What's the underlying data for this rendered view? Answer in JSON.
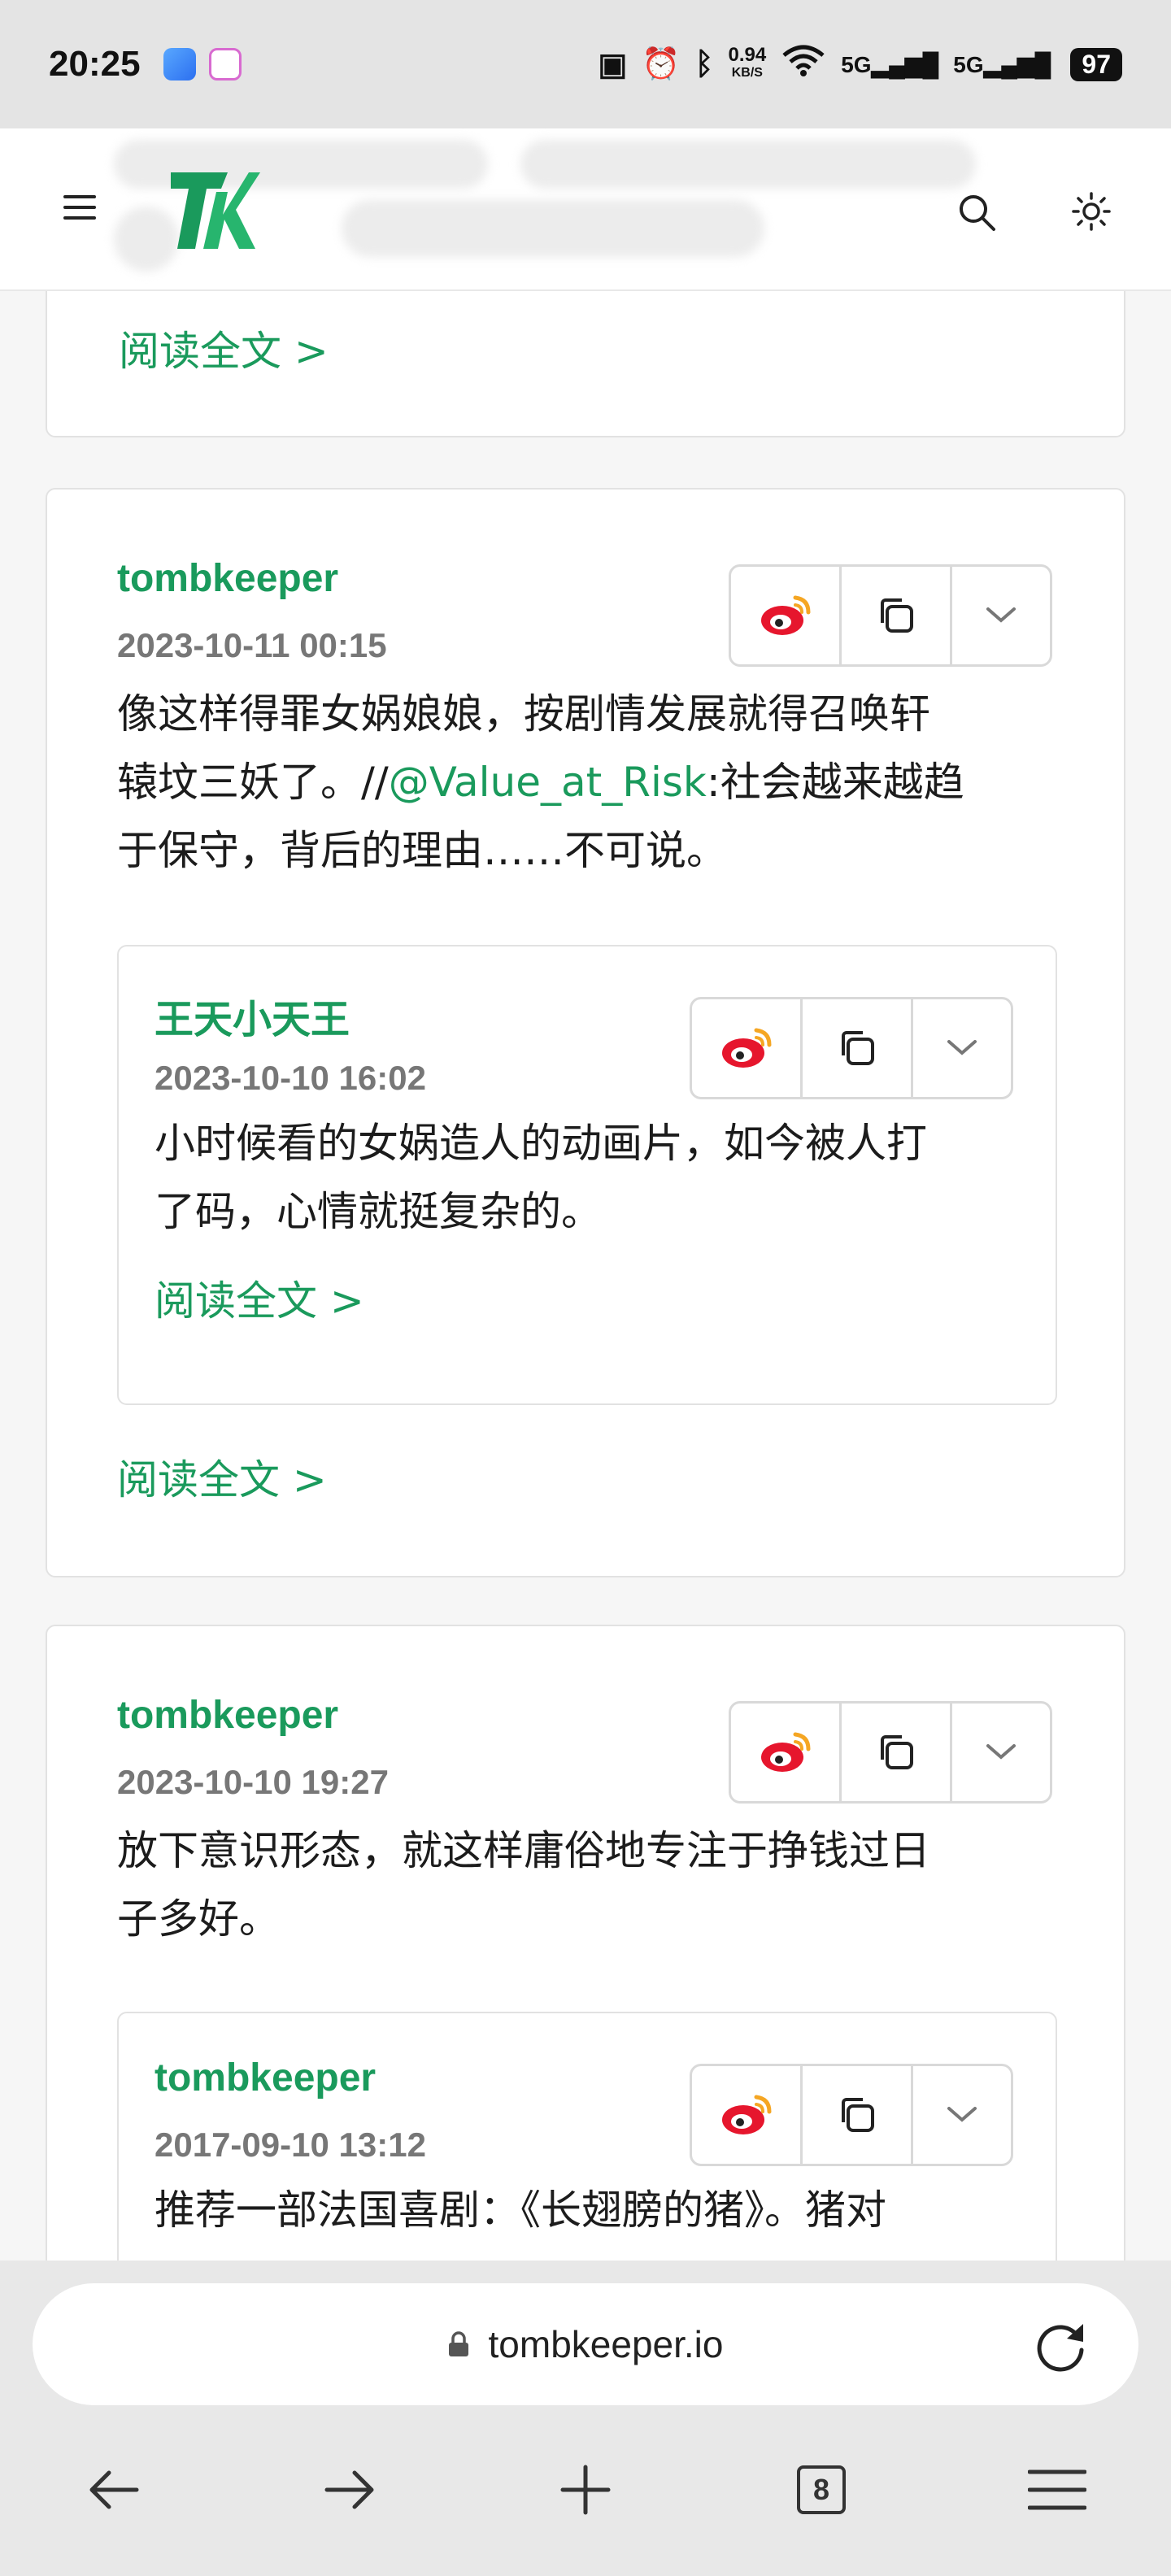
{
  "status_bar": {
    "time": "20:25",
    "net_speed_value": "0.94",
    "net_speed_unit": "KB/S",
    "signal_1": "5G",
    "signal_2": "5G",
    "battery": "97"
  },
  "header": {
    "logo_text": "TK",
    "icons": [
      "menu-icon",
      "search-icon",
      "theme-toggle-icon"
    ]
  },
  "top_card": {
    "read_more": "阅读全文 >"
  },
  "posts": [
    {
      "author": "tombkeeper",
      "date": "2023-10-11 00:15",
      "content_1": "像这样得罪女娲娘娘，按剧情发展就得召唤轩",
      "content_2a": "辕坟三妖了。//",
      "mention": "@Value_at_Risk",
      "content_2b": ":社会越来越趋",
      "content_3": "于保守，背后的理由……不可说。",
      "quote": {
        "author": "王天小天王",
        "date": "2023-10-10 16:02",
        "content_1": "小时候看的女娲造人的动画片，如今被人打",
        "content_2": "了码，心情就挺复杂的。",
        "read_more": "阅读全文 >"
      },
      "read_more": "阅读全文 >"
    },
    {
      "author": "tombkeeper",
      "date": "2023-10-10 19:27",
      "content_1": "放下意识形态，就这样庸俗地专注于挣钱过日",
      "content_2": "子多好。",
      "quote": {
        "author": "tombkeeper",
        "date": "2017-09-10 13:12",
        "content_1": "推荐一部法国喜剧：《长翅膀的猪》。猪对"
      }
    }
  ],
  "browser": {
    "url": "tombkeeper.io",
    "tab_count": "8"
  },
  "colors": {
    "accent": "#1a9a5c",
    "weibo_red": "#e6162d",
    "weibo_orange": "#f5a623"
  }
}
